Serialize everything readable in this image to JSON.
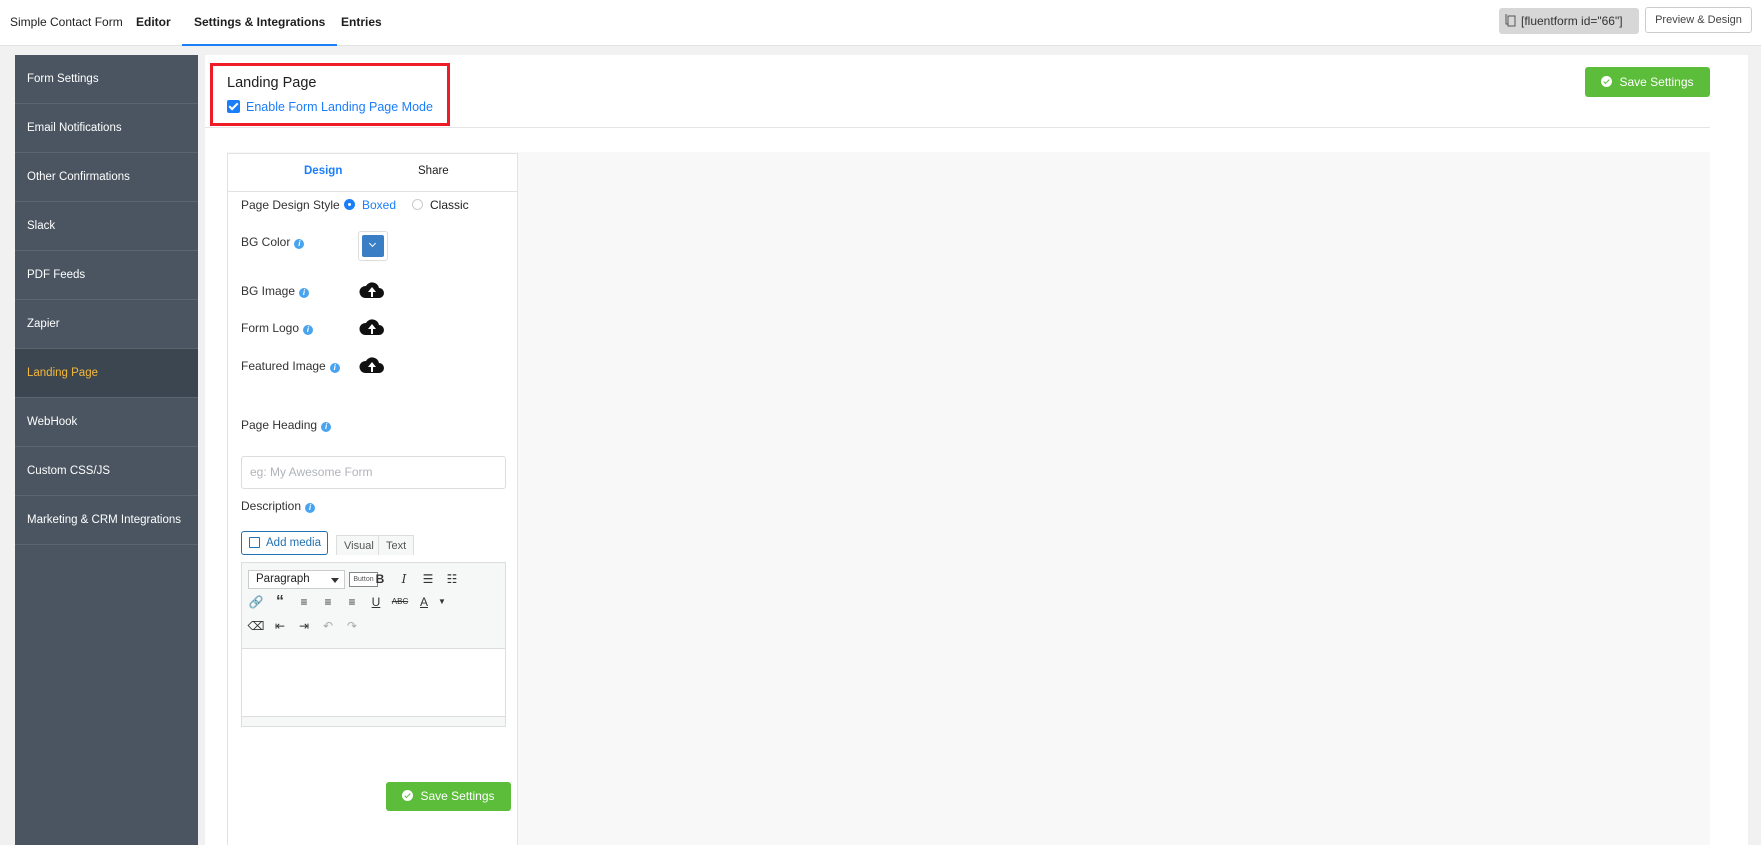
{
  "topbar": {
    "form_name": "Simple Contact Form",
    "tabs": [
      {
        "label": "Editor"
      },
      {
        "label": "Settings & Integrations"
      },
      {
        "label": "Entries"
      }
    ],
    "shortcode": "[fluentform id=\"66\"]",
    "preview_label": "Preview & Design"
  },
  "sidebar": {
    "items": [
      {
        "label": "Form Settings"
      },
      {
        "label": "Email Notifications"
      },
      {
        "label": "Other Confirmations"
      },
      {
        "label": "Slack"
      },
      {
        "label": "PDF Feeds"
      },
      {
        "label": "Zapier"
      },
      {
        "label": "Landing Page"
      },
      {
        "label": "WebHook"
      },
      {
        "label": "Custom CSS/JS"
      },
      {
        "label": "Marketing & CRM Integrations"
      }
    ],
    "active": "Landing Page"
  },
  "main": {
    "title": "Landing Page",
    "enable_label": "Enable Form Landing Page Mode",
    "enable_checked": true,
    "save_label": "Save Settings",
    "card": {
      "tabs": [
        {
          "label": "Design"
        },
        {
          "label": "Share"
        }
      ],
      "design_style_label": "Page Design Style",
      "design_style_options": [
        {
          "label": "Boxed"
        },
        {
          "label": "Classic"
        }
      ],
      "design_style_selected": "Boxed",
      "bg_color_label": "BG Color",
      "bg_color_value": "#3a7ec6",
      "bg_image_label": "BG Image",
      "form_logo_label": "Form Logo",
      "featured_image_label": "Featured Image",
      "page_heading_label": "Page Heading",
      "page_heading_placeholder": "eg: My Awesome Form",
      "description_label": "Description",
      "add_media_label": "Add media",
      "editor_tabs": [
        {
          "label": "Visual"
        },
        {
          "label": "Text"
        }
      ],
      "format_select_value": "Paragraph",
      "button_mini_label": "Button",
      "save_label": "Save Settings"
    }
  },
  "colors": {
    "accent": "#1a7efb",
    "sidebar_bg": "#4a5561",
    "active_text": "#f5b93b",
    "save_green": "#5cbd3a",
    "highlight": "#ee1c24"
  }
}
